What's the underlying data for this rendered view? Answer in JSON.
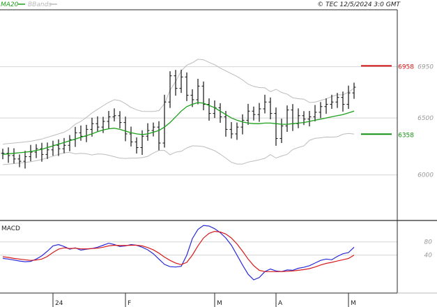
{
  "header": {
    "legend_ma": "MA20",
    "legend_bb": "BBands",
    "copyright": "© TEC 12/5/2024 3:0 GMT"
  },
  "macd_panel": {
    "title": "MACD"
  },
  "colors": {
    "ma": "#1aa01a",
    "bands": "#bcbcbc",
    "bars": "#111111",
    "resistance": "#d01010",
    "support": "#129012",
    "macd_line": "#2a2ad8",
    "signal_line": "#d81a1a",
    "grid": "#d4d4d4",
    "frame": "#2a2a2a",
    "tick_text": "#9a9a9a"
  },
  "chart_data": [
    {
      "type": "line",
      "title": "",
      "y_ticks": [
        {
          "value": 6000,
          "label": "6000"
        },
        {
          "value": 6500,
          "label": "6500"
        },
        {
          "value": 6950,
          "label": "6950"
        }
      ],
      "ylim": [
        5600,
        7450
      ],
      "x_labels": [
        {
          "label": "24",
          "bar_index": 9
        },
        {
          "label": "F",
          "bar_index": 22
        },
        {
          "label": "M",
          "bar_index": 38
        },
        {
          "label": "A",
          "bar_index": 49
        },
        {
          "label": "M",
          "bar_index": 62
        }
      ],
      "bars_approx_close": [
        6190,
        6170,
        6140,
        6120,
        6160,
        6200,
        6230,
        6180,
        6220,
        6260,
        6230,
        6260,
        6310,
        6370,
        6340,
        6400,
        6450,
        6420,
        6470,
        6510,
        6520,
        6460,
        6360,
        6290,
        6240,
        6340,
        6390,
        6420,
        6280,
        6640,
        6870,
        6760,
        6860,
        6700,
        6660,
        6780,
        6620,
        6540,
        6590,
        6510,
        6400,
        6360,
        6420,
        6480,
        6560,
        6530,
        6580,
        6640,
        6540,
        6320,
        6430,
        6570,
        6450,
        6520,
        6490,
        6510,
        6550,
        6600,
        6620,
        6640,
        6680,
        6620,
        6720,
        6770
      ],
      "levels": [
        {
          "label": "6958",
          "value": 6958,
          "kind": "resistance"
        },
        {
          "label": "6358",
          "value": 6358,
          "kind": "support"
        }
      ],
      "series": [
        {
          "name": "MA20",
          "values": [
            6180,
            6185,
            6190,
            6195,
            6200,
            6205,
            6215,
            6225,
            6240,
            6255,
            6270,
            6285,
            6300,
            6315,
            6330,
            6345,
            6360,
            6380,
            6395,
            6405,
            6410,
            6400,
            6385,
            6370,
            6360,
            6355,
            6360,
            6375,
            6390,
            6420,
            6460,
            6510,
            6560,
            6600,
            6620,
            6635,
            6630,
            6610,
            6590,
            6560,
            6530,
            6500,
            6480,
            6465,
            6455,
            6450,
            6450,
            6455,
            6455,
            6450,
            6445,
            6445,
            6450,
            6455,
            6460,
            6470,
            6480,
            6490,
            6500,
            6510,
            6520,
            6530,
            6545,
            6560
          ]
        },
        {
          "name": "BBands",
          "values": []
        }
      ]
    },
    {
      "type": "line",
      "title": "MACD",
      "y_ticks": [
        {
          "value": 80,
          "label": "80"
        },
        {
          "value": 40,
          "label": "40"
        }
      ],
      "ylim": [
        -75,
        145
      ],
      "series": [
        {
          "name": "",
          "values": [
            30,
            28,
            25,
            22,
            20,
            21,
            28,
            38,
            52,
            68,
            72,
            66,
            58,
            62,
            55,
            58,
            60,
            64,
            70,
            76,
            72,
            66,
            68,
            72,
            70,
            64,
            56,
            44,
            28,
            12,
            5,
            4,
            6,
            40,
            90,
            118,
            130,
            128,
            120,
            108,
            92,
            70,
            40,
            10,
            -18,
            -35,
            -28,
            -10,
            -2,
            -8,
            -10,
            -5,
            -6,
            0,
            3,
            8,
            16,
            24,
            28,
            26,
            36,
            44,
            48,
            64
          ]
        },
        {
          "name": "",
          "values": [
            35,
            33,
            30,
            28,
            26,
            24,
            25,
            28,
            36,
            48,
            58,
            62,
            60,
            61,
            59,
            59,
            60,
            61,
            64,
            68,
            70,
            69,
            69,
            70,
            70,
            68,
            63,
            56,
            46,
            34,
            24,
            16,
            11,
            18,
            40,
            68,
            92,
            106,
            112,
            110,
            104,
            92,
            74,
            52,
            28,
            8,
            -6,
            -10,
            -10,
            -10,
            -10,
            -9,
            -8,
            -6,
            -4,
            -1,
            4,
            10,
            15,
            18,
            22,
            26,
            30,
            40
          ]
        }
      ]
    }
  ]
}
